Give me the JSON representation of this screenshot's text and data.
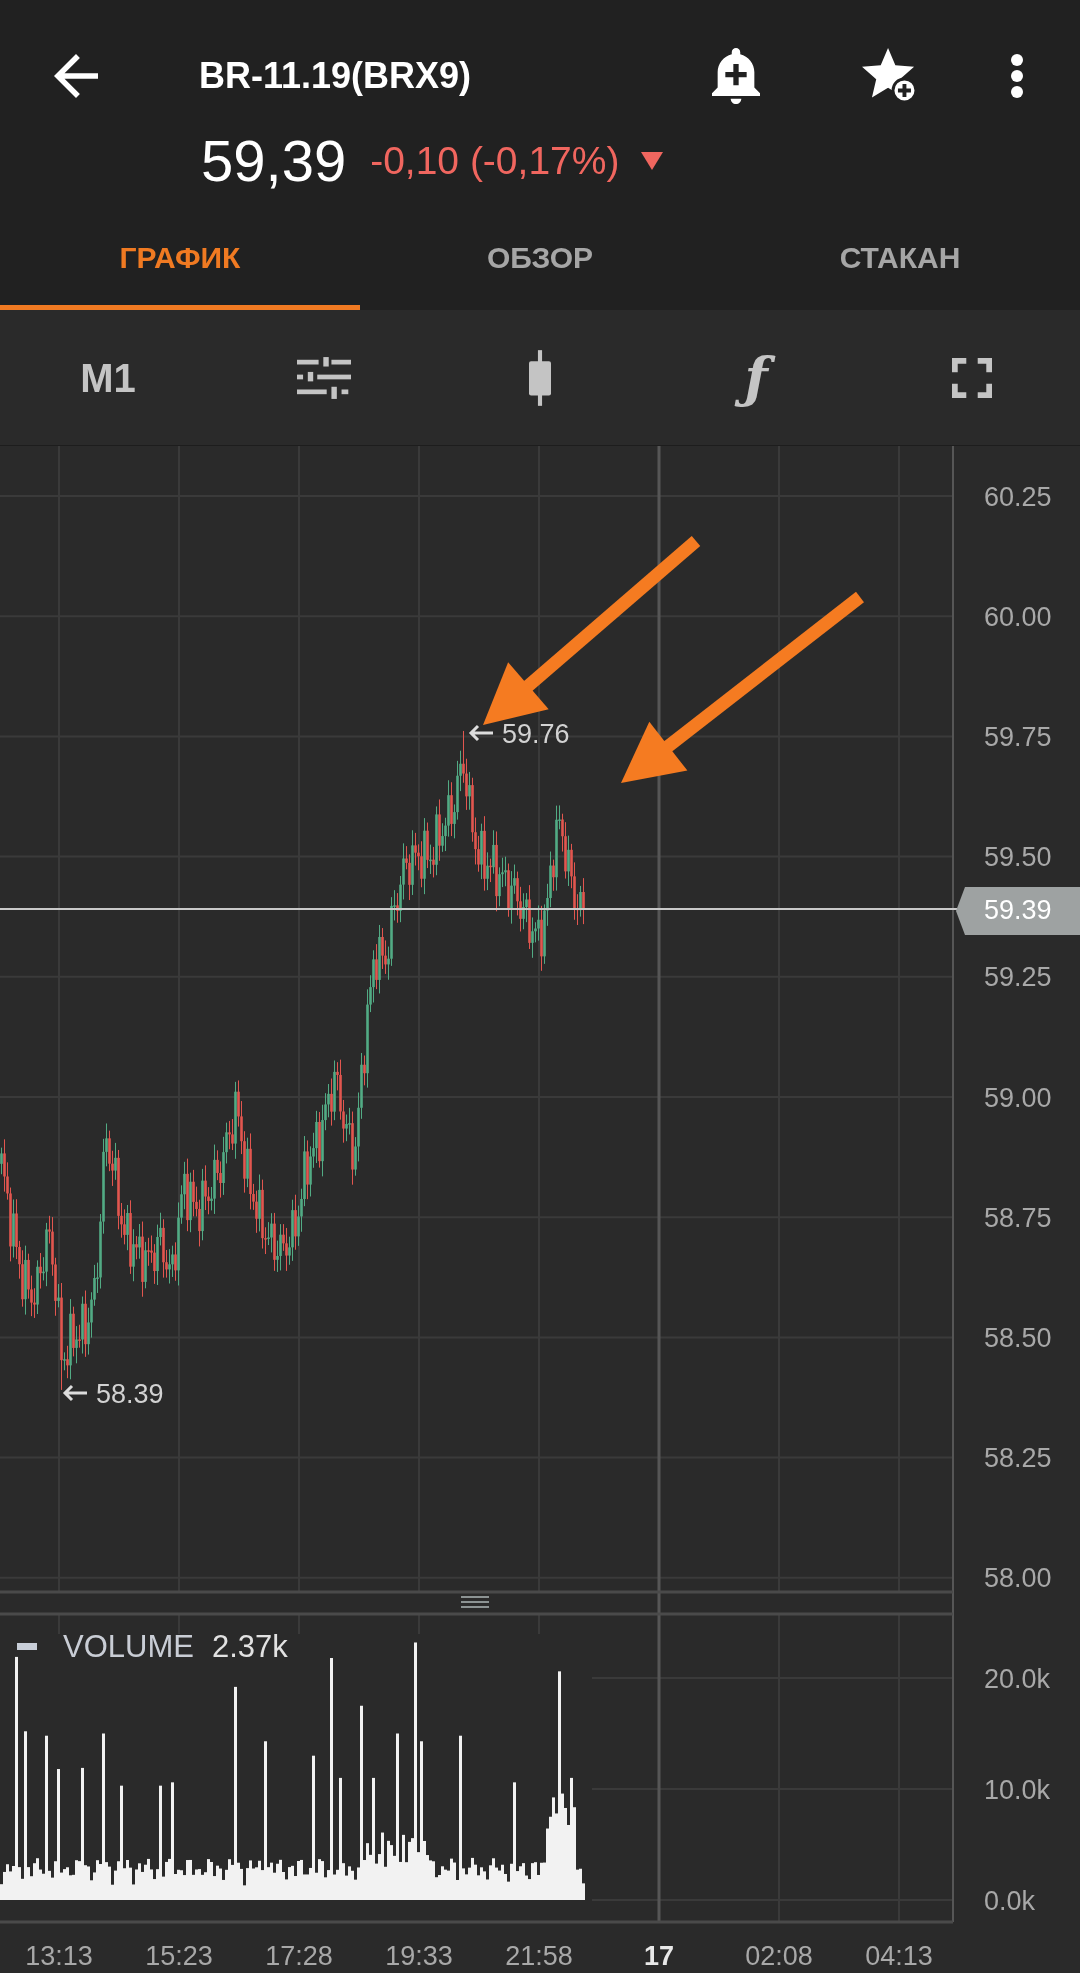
{
  "header": {
    "title": "BR-11.19(BRX9)",
    "last_price": "59,39",
    "change": "-0,10 (-0,17%)",
    "falling": true
  },
  "tabs": [
    {
      "label": "ГРАФИК",
      "selected": true
    },
    {
      "label": "ОБЗОР",
      "selected": false
    },
    {
      "label": "СТАКАН",
      "selected": false
    }
  ],
  "toolbar": {
    "timeframe": "M1",
    "function_glyph": "ƒ"
  },
  "price_chart": {
    "y_labels": [
      "60.25",
      "60.00",
      "59.75",
      "59.50",
      "59.25",
      "59.00",
      "58.75",
      "58.50",
      "58.25",
      "58.00"
    ],
    "current_price": "59.39",
    "high_label": "59.76",
    "low_label": "58.39"
  },
  "volume_chart": {
    "legend": "VOLUME",
    "value": "2.37k",
    "y_labels": [
      "20.0k",
      "10.0k",
      "0.0k"
    ]
  },
  "time_axis": [
    {
      "label": "13:13",
      "kind": "time"
    },
    {
      "label": "15:23",
      "kind": "time"
    },
    {
      "label": "17:28",
      "kind": "time"
    },
    {
      "label": "19:33",
      "kind": "time"
    },
    {
      "label": "21:58",
      "kind": "time"
    },
    {
      "label": "17",
      "kind": "date"
    },
    {
      "label": "02:08",
      "kind": "time"
    },
    {
      "label": "04:13",
      "kind": "time"
    }
  ]
}
